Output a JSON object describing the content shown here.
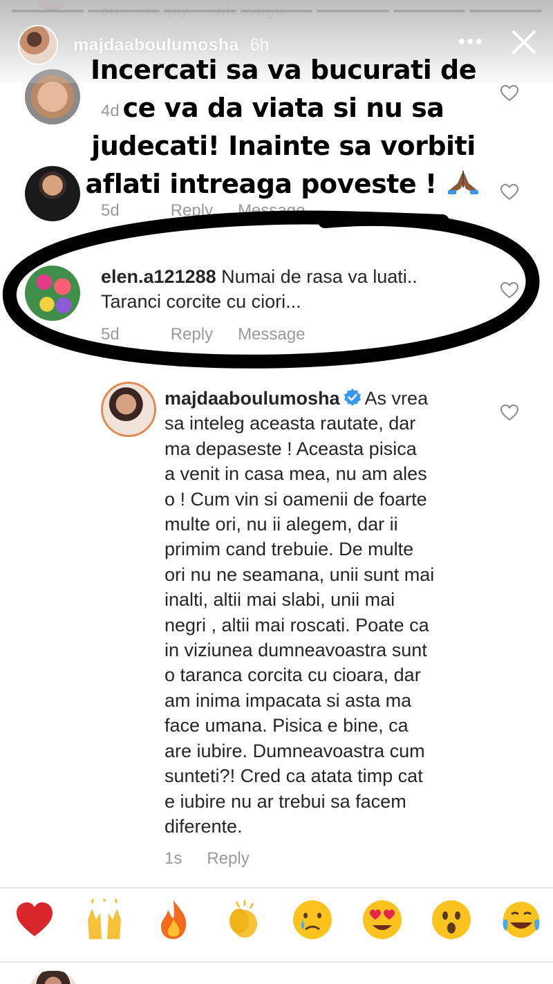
{
  "story": {
    "username": "majdaaboulumosha",
    "time": "6h",
    "more_icon": "more-horizontal-icon",
    "close_icon": "close-icon",
    "progress_segments": 7,
    "progress_done": 0
  },
  "ghost_row": {
    "time": "5d",
    "reply": "Reply",
    "message": "Message"
  },
  "overlay": {
    "line1": "Incercati sa va bucurati de",
    "line2": "ce va da viata si nu sa",
    "line3": "judecati! Inainte sa vorbiti",
    "line4": "aflati intreaga poveste !",
    "emoji": "folded-hands-emoji"
  },
  "comments": [
    {
      "time": "4d",
      "avatar": "girl-avatar"
    },
    {
      "time": "5d",
      "reply": "Reply",
      "message": "Message",
      "avatar": "man-avatar"
    },
    {
      "username": "elen.a121288",
      "text_line1": "Numai de rasa va luati..",
      "text_line2": "Taranci corcite cu ciori...",
      "time": "5d",
      "reply": "Reply",
      "message": "Message",
      "avatar": "flowers-avatar"
    }
  ],
  "reply": {
    "username": "majdaaboulumosha",
    "verified": true,
    "lines": [
      "As vrea",
      "sa inteleg aceasta rautate, dar",
      "ma depaseste ! Aceasta pisica",
      "a venit in casa mea, nu am ales",
      "o ! Cum vin si oamenii de foarte",
      "multe ori, nu ii alegem, dar ii",
      "primim cand trebuie. De multe",
      "ori nu ne seamana, unii sunt mai",
      "inalti, altii mai slabi, unii mai",
      "negri , altii mai roscati. Poate ca",
      "in viziunea dumneavoastra sunt",
      "o taranca corcita cu cioara, dar",
      "am inima impacata si asta ma",
      "face umana. Pisica e bine, ca",
      "are iubire. Dumneavoastra cum",
      "sunteti?! Cred ca atata timp cat",
      "e iubire nu ar trebui sa facem",
      "diferente."
    ],
    "time": "1s",
    "reply_label": "Reply"
  },
  "reactions": [
    "red-heart",
    "raising-hands",
    "fire",
    "clapping-hands",
    "crying-face",
    "heart-eyes-face",
    "surprised-face",
    "tears-of-joy-face"
  ],
  "colors": {
    "text": "#262626",
    "meta": "#9a9a9a",
    "verified": "#3897f0",
    "heart": "#d9262b"
  }
}
